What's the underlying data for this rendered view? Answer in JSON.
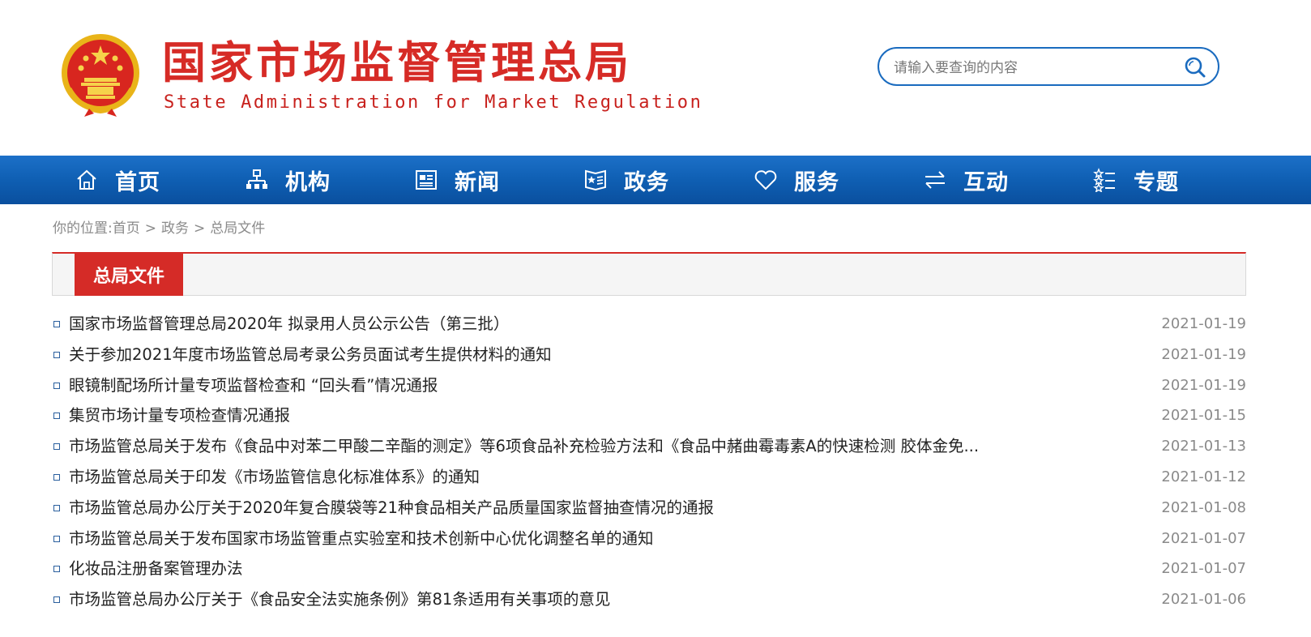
{
  "header": {
    "title": "国家市场监督管理总局",
    "subtitle": "State Administration for Market Regulation",
    "search_placeholder": "请输入要查询的内容"
  },
  "nav": [
    {
      "label": "首页",
      "icon": "home-icon"
    },
    {
      "label": "机构",
      "icon": "org-chart-icon"
    },
    {
      "label": "新闻",
      "icon": "newspaper-icon"
    },
    {
      "label": "政务",
      "icon": "government-affairs-icon"
    },
    {
      "label": "服务",
      "icon": "heart-icon"
    },
    {
      "label": "互动",
      "icon": "exchange-arrows-icon"
    },
    {
      "label": "专题",
      "icon": "topic-list-icon"
    }
  ],
  "breadcrumb": {
    "prefix": "你的位置:",
    "items": [
      "首页",
      "政务",
      "总局文件"
    ],
    "separator": ">"
  },
  "section": {
    "title": "总局文件"
  },
  "articles": [
    {
      "title": "国家市场监督管理总局2020年 拟录用人员公示公告（第三批）",
      "date": "2021-01-19"
    },
    {
      "title": "关于参加2021年度市场监管总局考录公务员面试考生提供材料的通知",
      "date": "2021-01-19"
    },
    {
      "title": "眼镜制配场所计量专项监督检查和 “回头看”情况通报",
      "date": "2021-01-19"
    },
    {
      "title": "集贸市场计量专项检查情况通报",
      "date": "2021-01-15"
    },
    {
      "title": "市场监管总局关于发布《食品中对苯二甲酸二辛酯的测定》等6项食品补充检验方法和《食品中赭曲霉毒素A的快速检测 胶体金免...",
      "date": "2021-01-13"
    },
    {
      "title": "市场监管总局关于印发《市场监管信息化标准体系》的通知",
      "date": "2021-01-12"
    },
    {
      "title": "市场监管总局办公厅关于2020年复合膜袋等21种食品相关产品质量国家监督抽查情况的通报",
      "date": "2021-01-08"
    },
    {
      "title": "市场监管总局关于发布国家市场监管重点实验室和技术创新中心优化调整名单的通知",
      "date": "2021-01-07"
    },
    {
      "title": "化妆品注册备案管理办法",
      "date": "2021-01-07"
    },
    {
      "title": "市场监管总局办公厅关于《食品安全法实施条例》第81条适用有关事项的意见",
      "date": "2021-01-06"
    }
  ],
  "colors": {
    "brand_red": "#d52b27",
    "nav_blue": "#0f5fb3",
    "search_border": "#1a6bbf"
  }
}
